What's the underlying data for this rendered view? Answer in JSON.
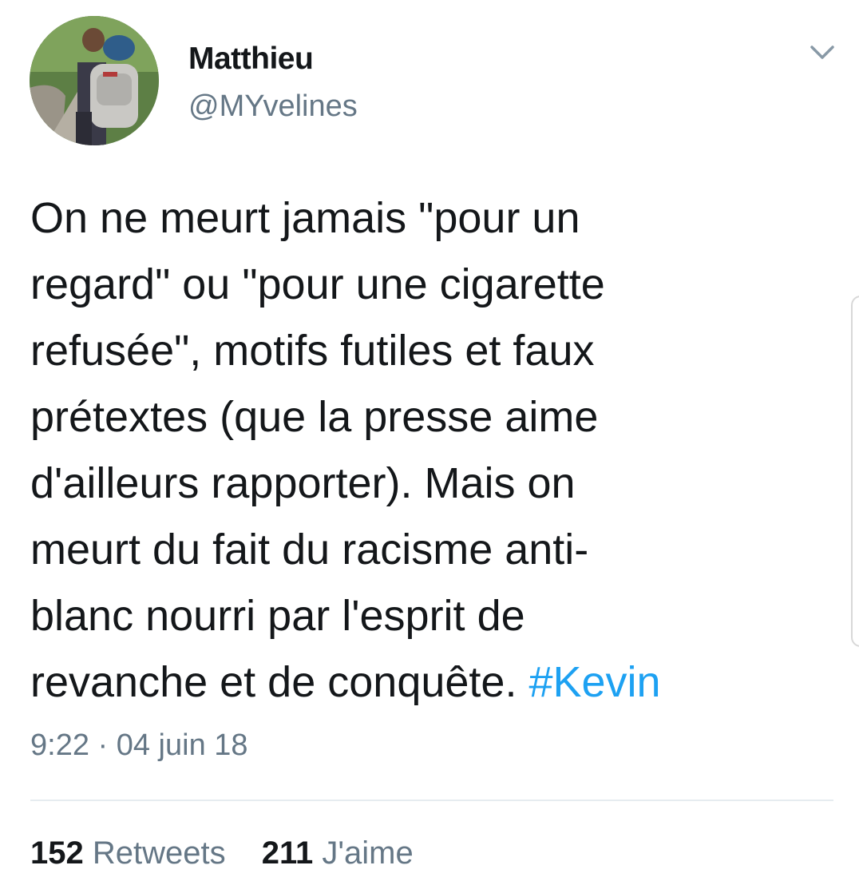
{
  "tweet": {
    "author": {
      "display_name": "Matthieu",
      "handle": "@MYvelines"
    },
    "text_lines": [
      "On ne meurt jamais \"pour un",
      "regard\" ou \"pour une cigarette",
      "refusée\", motifs futiles et faux",
      "prétextes (que la presse aime",
      "d'ailleurs rapporter). Mais on",
      "meurt du fait du racisme anti-",
      "blanc nourri par l'esprit de",
      "revanche et de conquête. "
    ],
    "hashtag": "#Kevin",
    "timestamp": "9:22 · 04 juin 18",
    "stats": {
      "retweets_count": "152",
      "retweets_label": "Retweets",
      "likes_count": "211",
      "likes_label": "J'aime"
    }
  },
  "icons": {
    "menu": "chevron-down-icon",
    "avatar": "profile-photo"
  },
  "colors": {
    "text": "#14171a",
    "secondary_text": "#657786",
    "hashtag": "#1da1f2",
    "divider": "#e6ecf0"
  }
}
